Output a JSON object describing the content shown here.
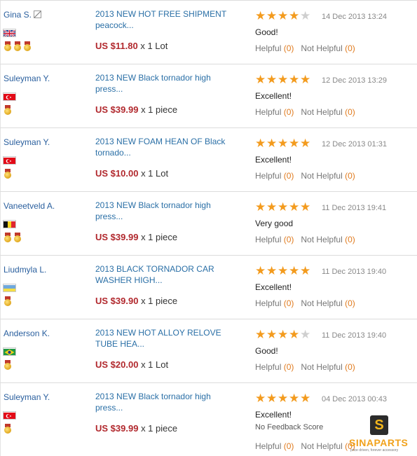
{
  "helpful_label": "Helpful",
  "not_helpful_label": "Not Helpful",
  "reviews": [
    {
      "buyer": "Gina S.",
      "flag": "uk",
      "medals": 3,
      "product": "2013 NEW HOT FREE SHIPMENT peacock...",
      "price": "US $11.80",
      "qty": "x 1 Lot",
      "rating": 4,
      "date": "14 Dec 2013 13:24",
      "comment": "Good!",
      "helpful": "(0)",
      "not_helpful": "(0)"
    },
    {
      "buyer": "Suleyman Y.",
      "flag": "tr",
      "medals": 1,
      "product": "2013 NEW Black tornador high press...",
      "price": "US $39.99",
      "qty": "x 1 piece",
      "rating": 5,
      "date": "12 Dec 2013 13:29",
      "comment": "Excellent!",
      "helpful": "(0)",
      "not_helpful": "(0)"
    },
    {
      "buyer": "Suleyman Y.",
      "flag": "tr",
      "medals": 1,
      "product": "2013 NEW FOAM HEAN OF Black tornado...",
      "price": "US $10.00",
      "qty": "x 1 Lot",
      "rating": 5,
      "date": "12 Dec 2013 01:31",
      "comment": "Excellent!",
      "helpful": "(0)",
      "not_helpful": "(0)"
    },
    {
      "buyer": "Vaneetveld A.",
      "flag": "be",
      "medals": 2,
      "product": "2013 NEW Black tornador high press...",
      "price": "US $39.99",
      "qty": "x 1 piece",
      "rating": 5,
      "date": "11 Dec 2013 19:41",
      "comment": "Very good",
      "helpful": "(0)",
      "not_helpful": "(0)"
    },
    {
      "buyer": "Liudmyla L.",
      "flag": "ua",
      "medals": 1,
      "product": "2013 BLACK TORNADOR CAR WASHER HIGH...",
      "price": "US $39.90",
      "qty": "x 1 piece",
      "rating": 5,
      "date": "11 Dec 2013 19:40",
      "comment": "Excellent!",
      "helpful": "(0)",
      "not_helpful": "(0)"
    },
    {
      "buyer": "Anderson K.",
      "flag": "br",
      "medals": 1,
      "product": "2013 NEW HOT ALLOY RELOVE TUBE HEA...",
      "price": "US $20.00",
      "qty": "x 1 Lot",
      "rating": 4,
      "date": "11 Dec 2013 19:40",
      "comment": "Good!",
      "helpful": "(0)",
      "not_helpful": "(0)"
    },
    {
      "buyer": "Suleyman Y.",
      "flag": "tr",
      "medals": 1,
      "product": "2013 NEW Black tornador high press...",
      "price": "US $39.99",
      "qty": "x 1 piece",
      "rating": 5,
      "date": "04 Dec 2013 00:43",
      "comment": "Excellent!",
      "no_feedback": "No Feedback Score",
      "helpful": "(0)",
      "not_helpful": "(0)"
    }
  ],
  "watermark": {
    "badge": "S",
    "brand": "SINAPARTS",
    "tagline": "price driven, forever accessory"
  },
  "colors": {
    "link": "#2a6fa6",
    "price": "#b1282d",
    "star": "#f39b1e",
    "count": "#e07b1f"
  }
}
